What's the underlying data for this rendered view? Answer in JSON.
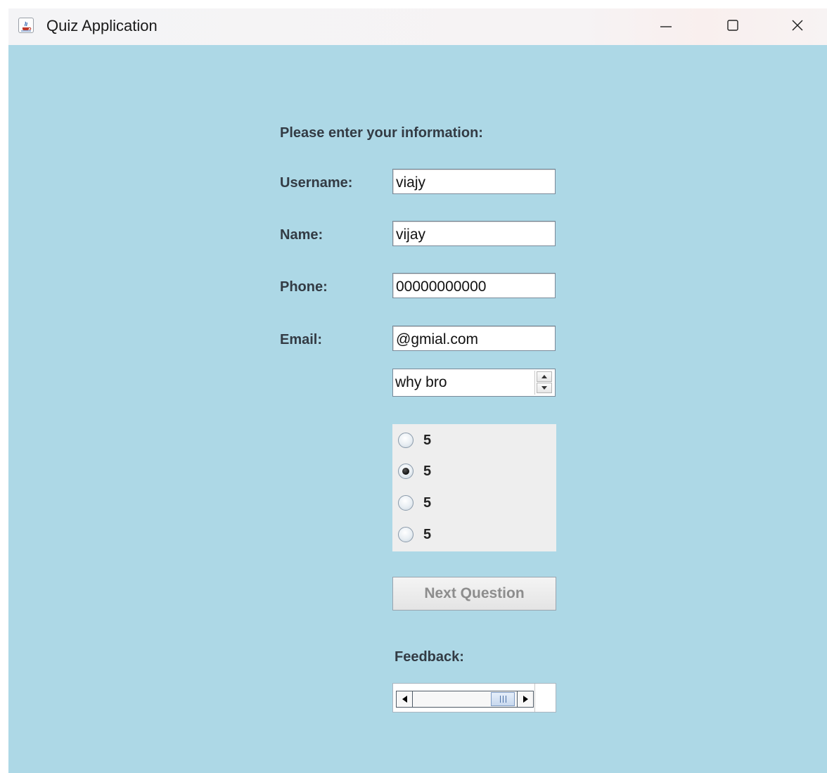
{
  "window": {
    "title": "Quiz Application",
    "icon": "java-cup-icon",
    "controls": {
      "minimize": "minimize-icon",
      "maximize": "maximize-icon",
      "close": "close-icon"
    }
  },
  "form": {
    "heading": "Please enter your information:",
    "username": {
      "label": "Username:",
      "value": "viajy"
    },
    "name": {
      "label": "Name:",
      "value": "vijay"
    },
    "phone": {
      "label": "Phone:",
      "value": "00000000000"
    },
    "email": {
      "label": "Email:",
      "value": "@gmial.com"
    }
  },
  "question_spinner": {
    "value": "why bro"
  },
  "options": [
    {
      "label": "5",
      "checked": false
    },
    {
      "label": "5",
      "checked": true
    },
    {
      "label": "5",
      "checked": false
    },
    {
      "label": "5",
      "checked": false
    }
  ],
  "next_button": {
    "label": "Next Question",
    "enabled": false
  },
  "feedback": {
    "label": "Feedback:"
  },
  "colors": {
    "background": "#add8e6",
    "panel": "#eeeeee",
    "label_text": "#333b44",
    "disabled_text": "#8d8d8d"
  }
}
